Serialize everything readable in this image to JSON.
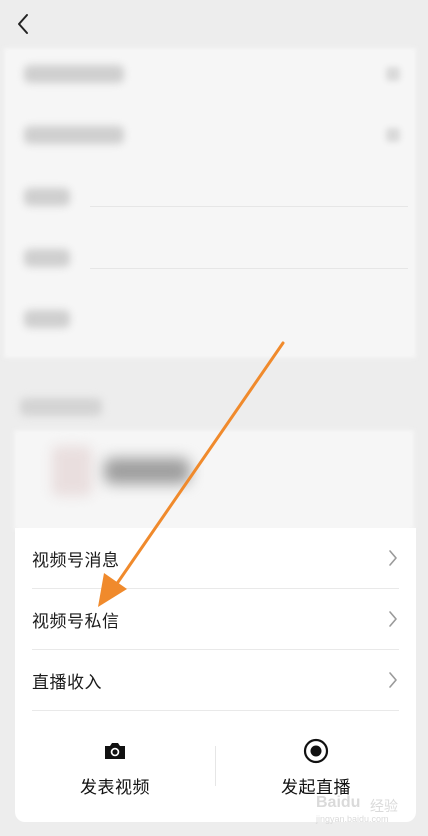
{
  "topbar": {
    "back_icon": "chevron-left-icon"
  },
  "menu": {
    "items": [
      {
        "label": "视频号消息"
      },
      {
        "label": "视频号私信"
      },
      {
        "label": "直播收入"
      }
    ],
    "actions": [
      {
        "label": "发表视频",
        "icon": "camera-icon"
      },
      {
        "label": "发起直播",
        "icon": "record-icon"
      }
    ]
  },
  "annotation": {
    "arrow_color": "#f08a2c",
    "target": "视频号私信"
  },
  "watermark": {
    "text": "Baidu",
    "sub": "经验",
    "url": "jingyan.baidu.com"
  }
}
